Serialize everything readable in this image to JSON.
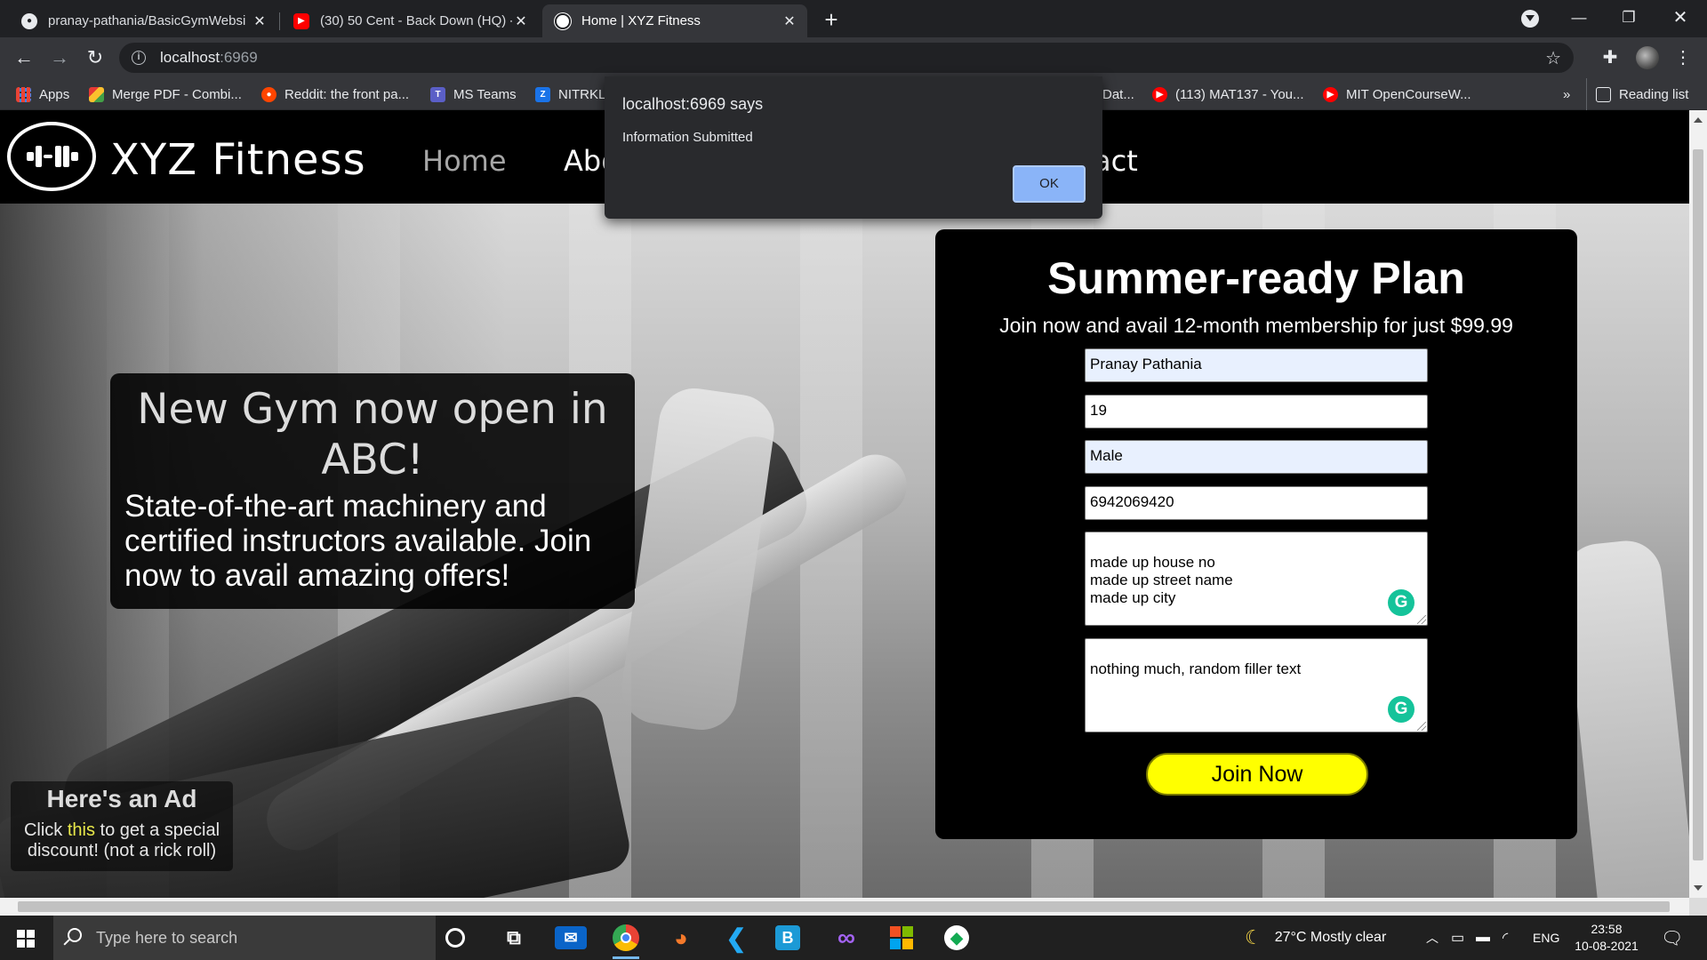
{
  "browser": {
    "tabs": [
      {
        "title": "pranay-pathania/BasicGymWebsi",
        "icon": "github-icon",
        "active": false
      },
      {
        "title": "(30) 50 Cent - Back Down (HQ) -",
        "icon": "youtube-icon",
        "active": false
      },
      {
        "title": "Home | XYZ Fitness",
        "icon": "site-icon",
        "active": true
      }
    ],
    "url_host": "localhost",
    "url_port": ":6969",
    "bookmarks": [
      {
        "label": "Apps",
        "icon": "apps-grid-icon"
      },
      {
        "label": "Merge PDF - Combi...",
        "icon": "ilovepdf-icon"
      },
      {
        "label": "Reddit: the front pa...",
        "icon": "reddit-icon"
      },
      {
        "label": "MS Teams",
        "icon": "teams-icon"
      },
      {
        "label": "NITRKL",
        "icon": "zoom-icon"
      },
      {
        "label": "Dat...",
        "icon": ""
      },
      {
        "label": "(113) MAT137 - You...",
        "icon": "youtube-icon"
      },
      {
        "label": "MIT OpenCourseW...",
        "icon": "youtube-icon"
      }
    ],
    "overflow_label": "»",
    "reading_list": "Reading list"
  },
  "site": {
    "brand": "XYZ Fitness",
    "nav": {
      "home": "Home",
      "about": "Abo",
      "contact": "act"
    },
    "promo": {
      "title": "New Gym now open in ABC!",
      "body": "State-of-the-art machinery and certified instructors available. Join now to avail amazing offers!"
    },
    "ad": {
      "title": "Here's an Ad",
      "text_before": "Click ",
      "link": "this",
      "text_after": " to get a special discount! (not a rick roll)"
    },
    "form": {
      "title": "Summer-ready Plan",
      "subtitle": "Join now and avail 12-month membership for just $99.99",
      "name": "Pranay Pathania",
      "age": "19",
      "gender": "Male",
      "phone": "6942069420",
      "address": "made up house no\nmade up street name\nmade up city",
      "notes": "nothing much, random filler text",
      "submit": "Join Now"
    }
  },
  "dialog": {
    "title": "localhost:6969 says",
    "message": "Information Submitted",
    "ok": "OK"
  },
  "taskbar": {
    "search_placeholder": "Type here to search",
    "weather": "27°C  Mostly clear",
    "language": "ENG",
    "time": "23:58",
    "date": "10-08-2021"
  }
}
